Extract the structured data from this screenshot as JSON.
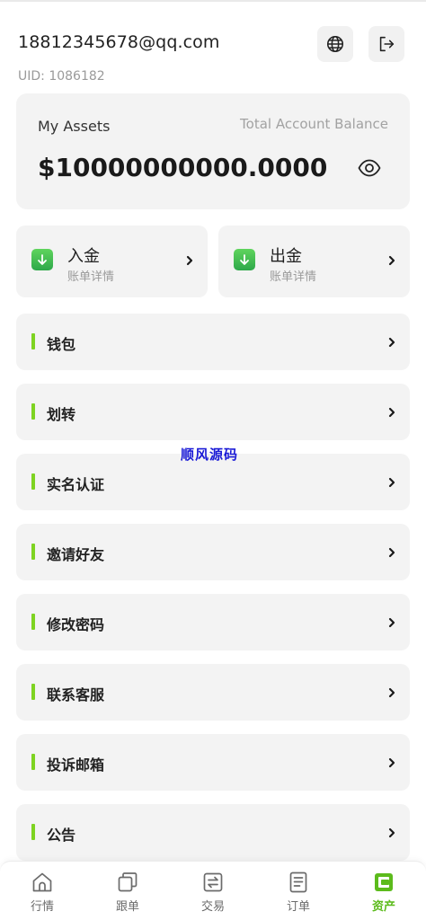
{
  "header": {
    "email": "18812345678@qq.com",
    "uid": "UID: 1086182"
  },
  "assets": {
    "label": "My Assets",
    "total_label": "Total Account Balance",
    "amount": "$10000000000.0000"
  },
  "funds": [
    {
      "title": "入金",
      "subtitle": "账单详情"
    },
    {
      "title": "出金",
      "subtitle": "账单详情"
    }
  ],
  "menu": [
    {
      "label": "钱包"
    },
    {
      "label": "划转"
    },
    {
      "label": "实名认证"
    },
    {
      "label": "邀请好友"
    },
    {
      "label": "修改密码"
    },
    {
      "label": "联系客服"
    },
    {
      "label": "投诉邮箱"
    },
    {
      "label": "公告"
    }
  ],
  "watermark": "顺风源码",
  "tabbar": [
    {
      "label": "行情",
      "icon": "home-icon"
    },
    {
      "label": "跟单",
      "icon": "copy-icon"
    },
    {
      "label": "交易",
      "icon": "exchange-icon"
    },
    {
      "label": "订单",
      "icon": "document-icon"
    },
    {
      "label": "资产",
      "icon": "wallet-icon",
      "active": true
    }
  ],
  "colors": {
    "accent": "#7ed321",
    "active_tab": "#5cbb1c",
    "fund_icon": "#3cbf4f",
    "card_bg": "#f3f3f3",
    "watermark": "#1a1ad6"
  }
}
